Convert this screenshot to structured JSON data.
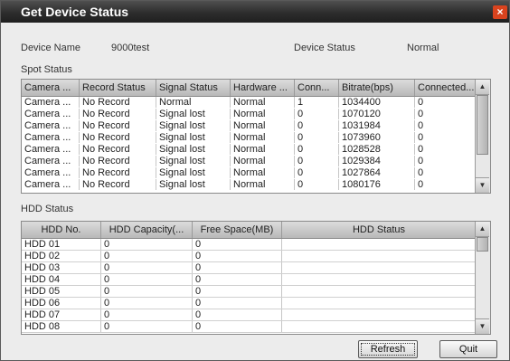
{
  "window": {
    "title": "Get Device Status",
    "close_glyph": "×"
  },
  "device": {
    "name_label": "Device Name",
    "name_value": "9000test",
    "status_label": "Device Status",
    "status_value": "Normal"
  },
  "spot": {
    "section_label": "Spot Status",
    "columns": [
      "Camera ...",
      "Record Status",
      "Signal Status",
      "Hardware ...",
      "Conn...",
      "Bitrate(bps)",
      "Connected..."
    ],
    "rows": [
      [
        "Camera ...",
        "No Record",
        "Normal",
        "Normal",
        "1",
        "1034400",
        "0"
      ],
      [
        "Camera ...",
        "No Record",
        "Signal lost",
        "Normal",
        "0",
        "1070120",
        "0"
      ],
      [
        "Camera ...",
        "No Record",
        "Signal lost",
        "Normal",
        "0",
        "1031984",
        "0"
      ],
      [
        "Camera ...",
        "No Record",
        "Signal lost",
        "Normal",
        "0",
        "1073960",
        "0"
      ],
      [
        "Camera ...",
        "No Record",
        "Signal lost",
        "Normal",
        "0",
        "1028528",
        "0"
      ],
      [
        "Camera ...",
        "No Record",
        "Signal lost",
        "Normal",
        "0",
        "1029384",
        "0"
      ],
      [
        "Camera ...",
        "No Record",
        "Signal lost",
        "Normal",
        "0",
        "1027864",
        "0"
      ],
      [
        "Camera ...",
        "No Record",
        "Signal lost",
        "Normal",
        "0",
        "1080176",
        "0"
      ]
    ]
  },
  "hdd": {
    "section_label": "HDD Status",
    "columns": [
      "HDD No.",
      "HDD Capacity(...",
      "Free Space(MB)",
      "HDD Status"
    ],
    "rows": [
      [
        "HDD 01",
        "0",
        "0",
        ""
      ],
      [
        "HDD 02",
        "0",
        "0",
        ""
      ],
      [
        "HDD 03",
        "0",
        "0",
        ""
      ],
      [
        "HDD 04",
        "0",
        "0",
        ""
      ],
      [
        "HDD 05",
        "0",
        "0",
        ""
      ],
      [
        "HDD 06",
        "0",
        "0",
        ""
      ],
      [
        "HDD 07",
        "0",
        "0",
        ""
      ],
      [
        "HDD 08",
        "0",
        "0",
        ""
      ]
    ]
  },
  "buttons": {
    "refresh": "Refresh",
    "quit": "Quit"
  },
  "scroll": {
    "up_glyph": "▲",
    "down_glyph": "▼"
  },
  "colors": {
    "titlebar": "#2d2d2d",
    "close": "#d9431e",
    "header": "#c8c8c8"
  }
}
